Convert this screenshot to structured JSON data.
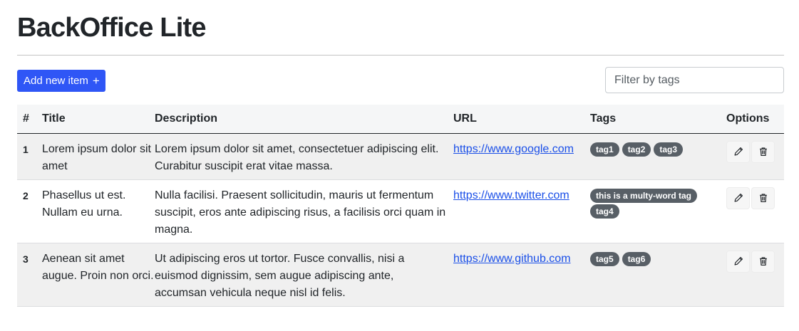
{
  "app": {
    "title": "BackOffice Lite"
  },
  "toolbar": {
    "add_label": "Add new item",
    "add_icon": "plus-icon",
    "filter_placeholder": "Filter by tags"
  },
  "table": {
    "headers": [
      "#",
      "Title",
      "Description",
      "URL",
      "Tags",
      "Options"
    ],
    "rows": [
      {
        "num": "1",
        "title": "Lorem ipsum dolor sit amet",
        "description": "Lorem ipsum dolor sit amet, consectetuer adipiscing elit. Curabitur suscipit erat vitae massa.",
        "url": "https://www.google.com",
        "tags": [
          "tag1",
          "tag2",
          "tag3"
        ]
      },
      {
        "num": "2",
        "title": "Phasellus ut est. Nullam eu urna.",
        "description": "Nulla facilisi. Praesent sollicitudin, mauris ut fermentum suscipit, eros ante adipiscing risus, a facilisis orci quam in magna.",
        "url": "https://www.twitter.com",
        "tags": [
          "this is a multy-word tag",
          "tag4"
        ]
      },
      {
        "num": "3",
        "title": "Aenean sit amet augue. Proin non orci.",
        "description": "Ut adipiscing eros ut tortor. Fusce convallis, nisi a euismod dignissim, sem augue adipiscing ante, accumsan vehicula neque nisl id felis.",
        "url": "https://www.github.com",
        "tags": [
          "tag5",
          "tag6"
        ]
      }
    ],
    "option_icons": [
      "pencil-icon",
      "trash-icon"
    ]
  },
  "colors": {
    "primary": "#2f56f6",
    "tag_bg": "#585f66",
    "link": "#1a4fe8",
    "stripe": "#f0f0f0",
    "header_bg": "#f5f6f7"
  }
}
